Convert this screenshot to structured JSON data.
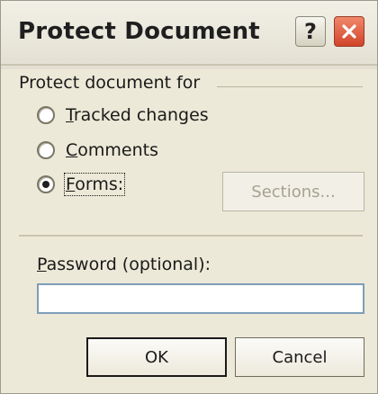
{
  "window": {
    "title": "Protect Document",
    "help_icon": "help-icon",
    "help_glyph": "?",
    "close_icon": "close-icon"
  },
  "protect_group": {
    "label": "Protect document for"
  },
  "options": [
    {
      "mnemonic": "T",
      "rest": "racked changes",
      "selected": false
    },
    {
      "mnemonic": "C",
      "rest": "omments",
      "selected": false
    },
    {
      "mnemonic": "F",
      "rest": "orms:",
      "selected": true
    }
  ],
  "sections_button": {
    "label": "Sections...",
    "enabled": false
  },
  "password": {
    "label_mnemonic": "P",
    "label_rest": "assword (optional):",
    "value": ""
  },
  "buttons": {
    "ok": "OK",
    "cancel": "Cancel"
  },
  "colors": {
    "dialog_bg": "#ece9d8",
    "close_button": "#d1442a",
    "input_border": "#7f9db9"
  }
}
